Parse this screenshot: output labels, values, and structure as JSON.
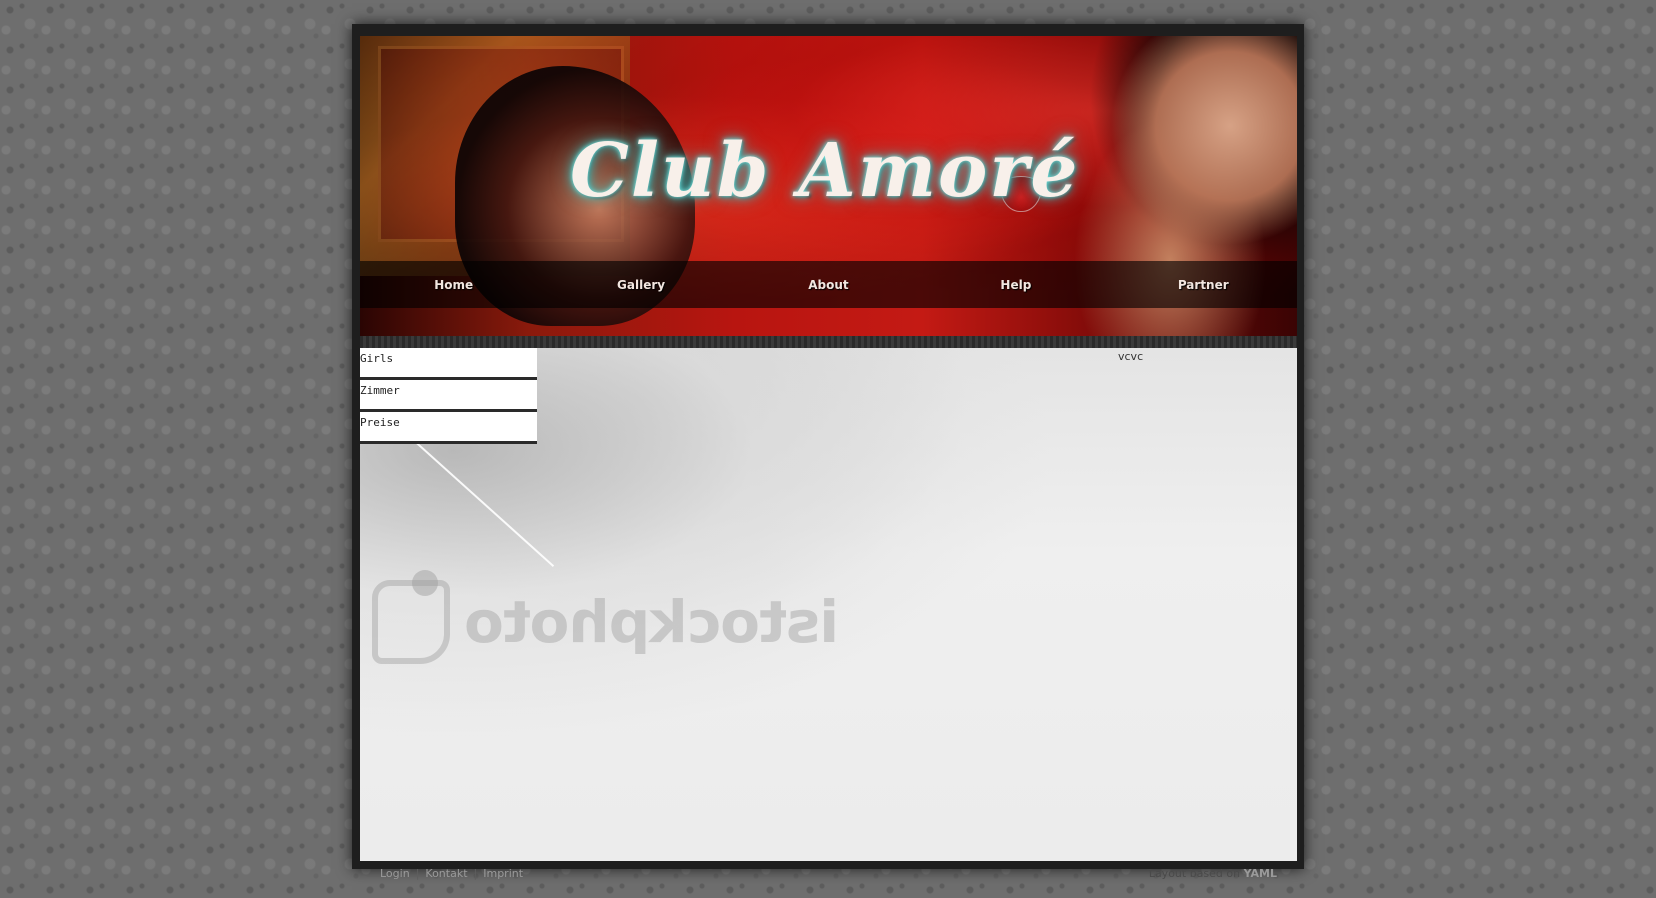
{
  "header": {
    "logo_text": "Club Amoré"
  },
  "nav": {
    "items": [
      {
        "label": "Home"
      },
      {
        "label": "Gallery"
      },
      {
        "label": "About"
      },
      {
        "label": "Help"
      },
      {
        "label": "Partner"
      }
    ]
  },
  "sidebar": {
    "items": [
      {
        "label": "Girls"
      },
      {
        "label": "Zimmer"
      },
      {
        "label": "Preise"
      }
    ]
  },
  "content": {
    "right_text": "vcvc",
    "watermark_text": "istockphoto"
  },
  "footer": {
    "links": [
      {
        "label": "Login"
      },
      {
        "label": "Kontakt"
      },
      {
        "label": "Imprint"
      }
    ],
    "separator": "|",
    "credit_prefix": "Layout based on",
    "credit_brand": "YAML"
  }
}
